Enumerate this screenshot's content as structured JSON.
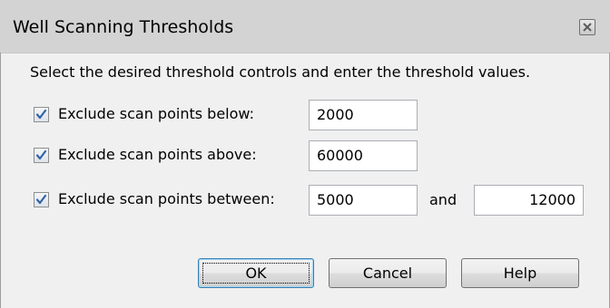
{
  "window": {
    "title": "Well Scanning Thresholds",
    "close_icon": "close-icon"
  },
  "instruction": "Select the desired threshold controls and enter the threshold values.",
  "thresholds": {
    "below": {
      "label": "Exclude scan points below:",
      "checked": true,
      "value": "2000"
    },
    "above": {
      "label": "Exclude scan points above:",
      "checked": true,
      "value": "60000"
    },
    "between": {
      "label": "Exclude scan points between:",
      "checked": true,
      "value_low": "5000",
      "and_label": "and",
      "value_high": "12000"
    }
  },
  "buttons": {
    "ok": "OK",
    "cancel": "Cancel",
    "help": "Help"
  }
}
